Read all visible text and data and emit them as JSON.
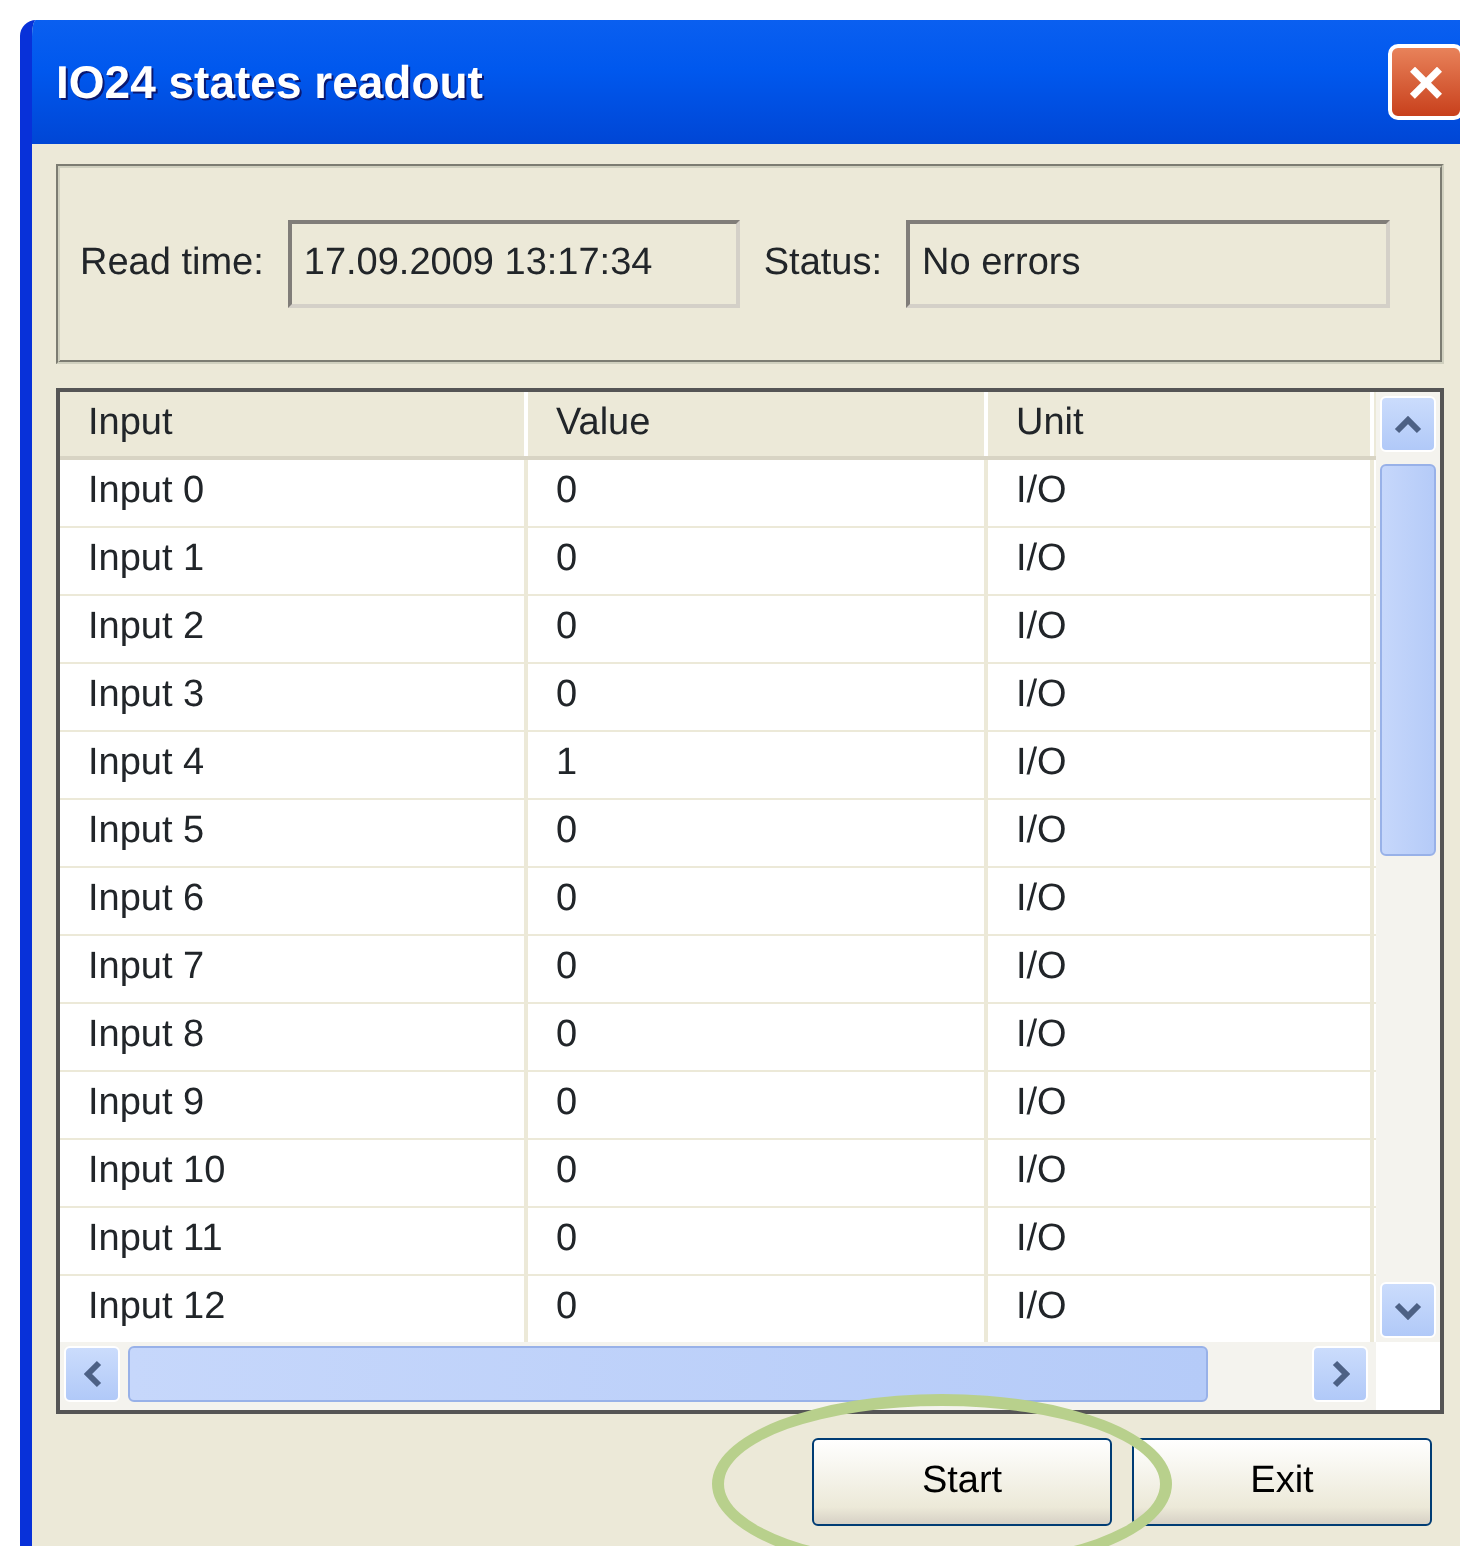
{
  "window": {
    "title": "IO24 states readout",
    "close": "×"
  },
  "info": {
    "read_time_label": "Read time:",
    "read_time": "17.09.2009 13:17:34",
    "status_label": "Status:",
    "status": "No errors"
  },
  "table": {
    "columns": [
      "Input",
      "Value",
      "Unit"
    ],
    "rows": [
      [
        "Input 0",
        "0",
        "I/O"
      ],
      [
        "Input 1",
        "0",
        "I/O"
      ],
      [
        "Input 2",
        "0",
        "I/O"
      ],
      [
        "Input 3",
        "0",
        "I/O"
      ],
      [
        "Input 4",
        "1",
        "I/O"
      ],
      [
        "Input 5",
        "0",
        "I/O"
      ],
      [
        "Input 6",
        "0",
        "I/O"
      ],
      [
        "Input 7",
        "0",
        "I/O"
      ],
      [
        "Input 8",
        "0",
        "I/O"
      ],
      [
        "Input 9",
        "0",
        "I/O"
      ],
      [
        "Input 10",
        "0",
        "I/O"
      ],
      [
        "Input 11",
        "0",
        "I/O"
      ],
      [
        "Input 12",
        "0",
        "I/O"
      ]
    ]
  },
  "buttons": [
    {
      "label": "Start",
      "highlighted": true
    },
    {
      "label": "Exit",
      "highlighted": false
    }
  ]
}
